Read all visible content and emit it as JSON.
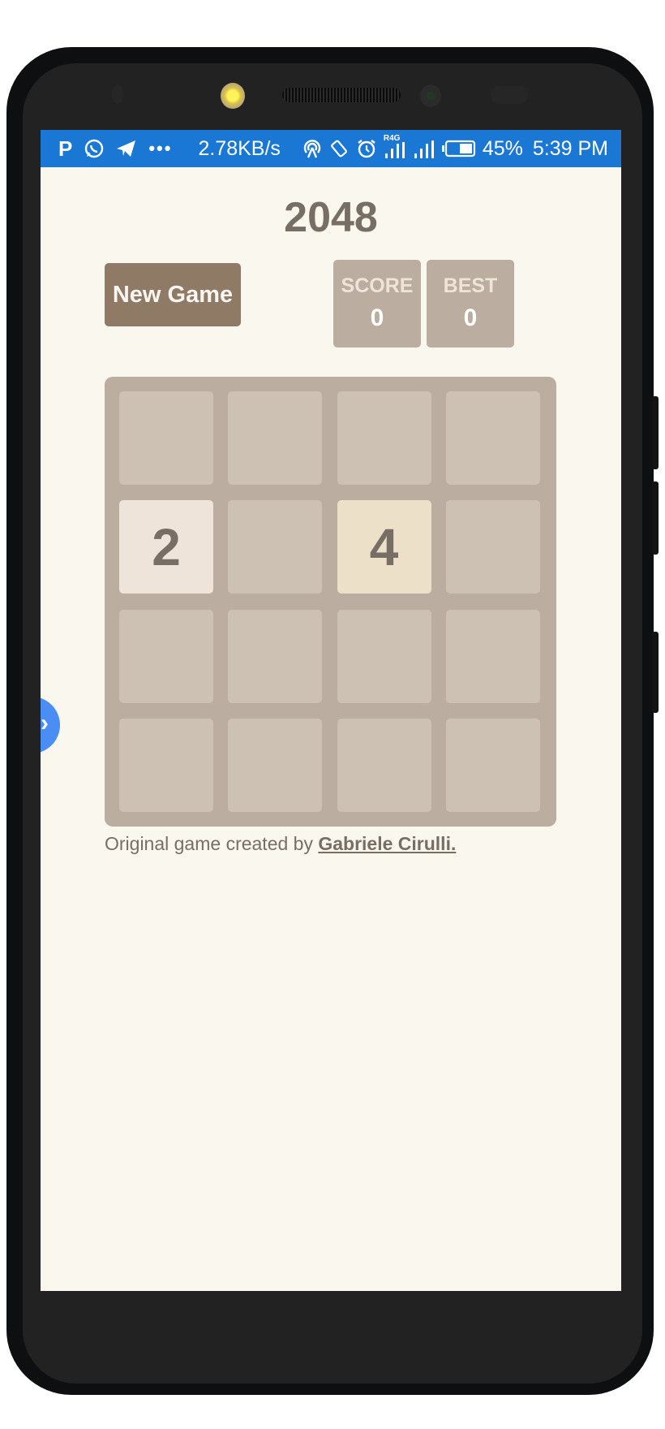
{
  "status_bar": {
    "left_icons": [
      "parking-icon",
      "whatsapp-icon",
      "telegram-icon",
      "more-icon"
    ],
    "network_speed": "2.78KB/s",
    "right_icons": [
      "hotspot-icon",
      "rotate-icon",
      "alarm-icon",
      "signal-r4g-icon",
      "signal-icon",
      "battery-icon"
    ],
    "network_label": "R4G",
    "battery": "45%",
    "time": "5:39 PM"
  },
  "game": {
    "title": "2048",
    "new_game_label": "New Game",
    "score_label": "SCORE",
    "score_value": "0",
    "best_label": "BEST",
    "best_value": "0",
    "board": [
      [
        "",
        "",
        "",
        ""
      ],
      [
        "2",
        "",
        "4",
        ""
      ],
      [
        "",
        "",
        "",
        ""
      ],
      [
        "",
        "",
        "",
        ""
      ]
    ],
    "tile_colors": {
      "empty": "#cdc1b4",
      "2": "#eee4da",
      "4": "#ede0c8"
    },
    "footer_text": "Original game created by ",
    "footer_link": "Gabriele Cirulli."
  },
  "floating_button": {
    "icon": "chevron-right-icon",
    "color": "#4a8ef5"
  }
}
